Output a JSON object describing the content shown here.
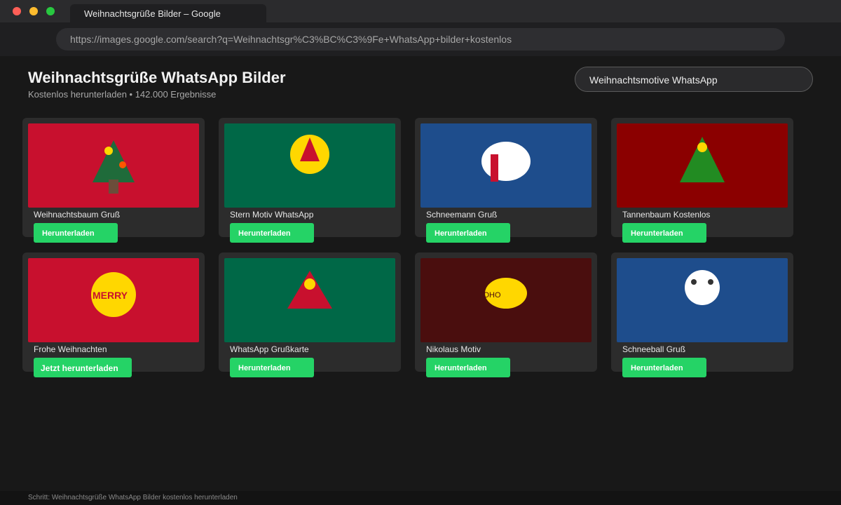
{
  "window": {
    "tab_title": "Weihnachtsgrüße Bilder – Google",
    "url": "https://images.google.com/search?q=Weihnachtsgr%C3%BC%C3%9Fe+WhatsApp+bilder+kostenlos"
  },
  "header": {
    "title": "Weihnachtsgrüße WhatsApp Bilder",
    "subtitle": "Kostenlos herunterladen • 142.000 Ergebnisse"
  },
  "search": {
    "value": "Weihnachtsmotive WhatsApp"
  },
  "colors": {
    "accent_green": "#25d366",
    "christmas_red": "#c8102e",
    "christmas_green": "#006847",
    "winter_blue": "#1e4d8c",
    "dark_red": "#8b0000",
    "maroon": "#4a0e0e",
    "gold": "#ffd700"
  },
  "results": [
    {
      "label": "Weihnachtsbaum Gruß",
      "button": "Herunterladen",
      "motif": "tree-icon",
      "bg": "#c8102e"
    },
    {
      "label": "Stern Motiv WhatsApp",
      "button": "Herunterladen",
      "motif": "star-icon",
      "bg": "#006847"
    },
    {
      "label": "Schneemann Gruß",
      "button": "Herunterladen",
      "motif": "snowman-icon",
      "bg": "#1e4d8c"
    },
    {
      "label": "Tannenbaum Kostenlos",
      "button": "Herunterladen",
      "motif": "fir-tree-icon",
      "bg": "#8b0000"
    },
    {
      "label": "Frohe Weihnachten",
      "button": "Jetzt herunterladen",
      "motif": "ornament-icon",
      "bg": "#c8102e",
      "motif_text": "MERRY"
    },
    {
      "label": "WhatsApp Grußkarte",
      "button": "Herunterladen",
      "motif": "triangle-icon",
      "bg": "#006847"
    },
    {
      "label": "Nikolaus Motiv",
      "button": "Herunterladen",
      "motif": "hohoho-icon",
      "bg": "#4a0e0e",
      "motif_text": "OHO"
    },
    {
      "label": "Schneeball Gruß",
      "button": "Herunterladen",
      "motif": "snowball-icon",
      "bg": "#1e4d8c"
    }
  ],
  "status": {
    "text": "Schritt: Weihnachtsgrüße WhatsApp Bilder kostenlos herunterladen"
  }
}
